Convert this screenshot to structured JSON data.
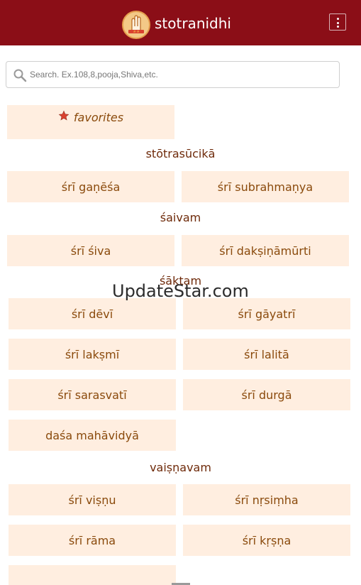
{
  "header": {
    "title": "stotranidhi",
    "logo_icon": "hand-blessing-logo",
    "menu_icon": "kebab-menu-icon",
    "bg_color": "#8b0e17"
  },
  "search": {
    "placeholder": "Search. Ex.108,8,pooja,Shiva,etc.",
    "value": ""
  },
  "favorites": {
    "label": "favorites",
    "icon": "star-icon"
  },
  "sections": {
    "stotrasucika": "stōtrasūcikā",
    "saivam": "śaivam",
    "saktam": "śāktam",
    "vaisnavam": "vaiṣṇavam"
  },
  "items": {
    "ganesa": "śrī gaṇēśa",
    "subrahmanya": "śrī subrahmaṇya",
    "siva": "śrī śiva",
    "daksinamurti": "śrī dakṣiṇāmūrti",
    "devi": "śrī dēvī",
    "gayatri": "śrī gāyatrī",
    "laksmi": "śrī lakṣmī",
    "lalita": "śrī lalitā",
    "sarasvati": "śrī sarasvatī",
    "durga": "śrī durgā",
    "mahavidya": "daśa mahāvidyā",
    "visnu": "śrī viṣṇu",
    "nrsimha": "śrī nṛsiṃha",
    "rama": "śrī rāma",
    "krsna": "śrī kṛṣṇa"
  },
  "watermark": "UpdateStar.com",
  "colors": {
    "card_bg": "#ffeee0",
    "card_text": "#8a4a0c",
    "heading_text": "#6e2a0a",
    "star": "#d9412f"
  }
}
